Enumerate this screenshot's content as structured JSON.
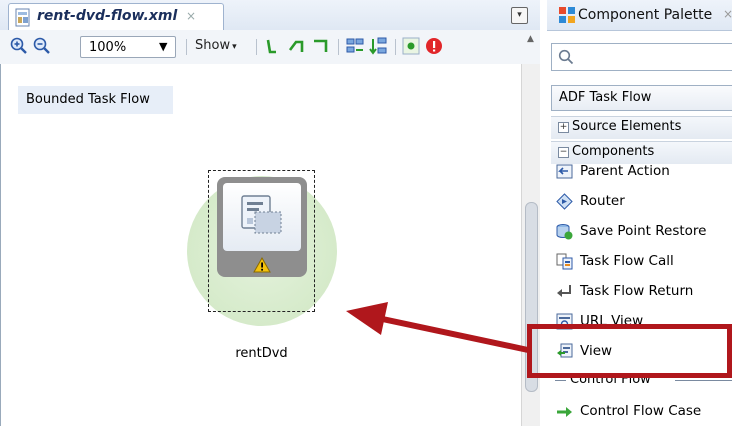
{
  "editor": {
    "tab_title": "rent-dvd-flow.xml",
    "tab_close": "×",
    "tabs_dropdown": "▾"
  },
  "toolbar": {
    "zoom_value": "100%",
    "zoom_arrow": "▼",
    "show_label": "Show",
    "show_arrow": "▾"
  },
  "canvas": {
    "bounded_label": "Bounded Task Flow",
    "activity_name": "rentDvd"
  },
  "palette": {
    "tab_title": "Component Palette",
    "tab_close": "×",
    "search_value": "",
    "category": "ADF Task Flow",
    "sections": [
      {
        "sign": "+",
        "label": "Source Elements"
      },
      {
        "sign": "−",
        "label": "Components"
      }
    ],
    "items": [
      {
        "label": "Parent Action",
        "icon": "parent-action-icon"
      },
      {
        "label": "Router",
        "icon": "router-icon"
      },
      {
        "label": "Save Point Restore",
        "icon": "save-point-restore-icon"
      },
      {
        "label": "Task Flow Call",
        "icon": "task-flow-call-icon"
      },
      {
        "label": "Task Flow Return",
        "icon": "task-flow-return-icon"
      },
      {
        "label": "URL View",
        "icon": "url-view-icon"
      },
      {
        "label": "View",
        "icon": "view-icon"
      }
    ],
    "control_flow_header": "Control Flow",
    "control_flow_item": "Control Flow Case"
  },
  "colors": {
    "annotation_red": "#b0171c",
    "halo_green": "#cfe7c2",
    "tab_blue": "#1b2f5c"
  }
}
